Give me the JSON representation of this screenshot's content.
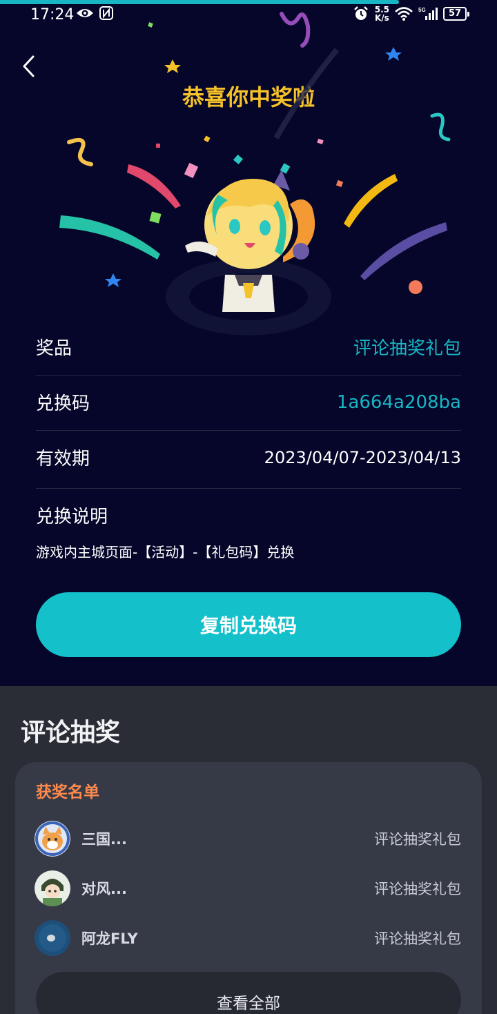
{
  "status_bar": {
    "time": "17:24",
    "net_speed_value": "5.5",
    "net_speed_unit": "K/s",
    "battery": "57",
    "icons": [
      "eye-icon",
      "nfc-icon",
      "alarm-icon",
      "wifi-icon",
      "5g-signal-icon",
      "battery-icon"
    ]
  },
  "header": {
    "title": "恭喜你中奖啦",
    "back_icon": "chevron-left-icon"
  },
  "prize_info": {
    "prize_label": "奖品",
    "prize_value": "评论抽奖礼包",
    "code_label": "兑换码",
    "code_value": "1a664a208ba",
    "validity_label": "有效期",
    "validity_value": "2023/04/07-2023/04/13",
    "instructions_label": "兑换说明",
    "instructions_text": "游戏内主城页面-【活动】-【礼包码】兑换"
  },
  "copy_button": {
    "label": "复制兑换码"
  },
  "lottery": {
    "section_title": "评论抽奖",
    "card_title": "获奖名单",
    "winners": [
      {
        "name": "三国...",
        "prize": "评论抽奖礼包"
      },
      {
        "name": "对风...",
        "prize": "评论抽奖礼包"
      },
      {
        "name": "阿龙FLY",
        "prize": "评论抽奖礼包"
      }
    ],
    "view_all_label": "查看全部"
  },
  "colors": {
    "background_top": "#050629",
    "accent_cyan": "#18b6c4",
    "title_yellow": "#f6c229",
    "card_orange": "#ff8a4d",
    "bottom_bg": "#2a2c36",
    "card_bg": "#363a47"
  }
}
